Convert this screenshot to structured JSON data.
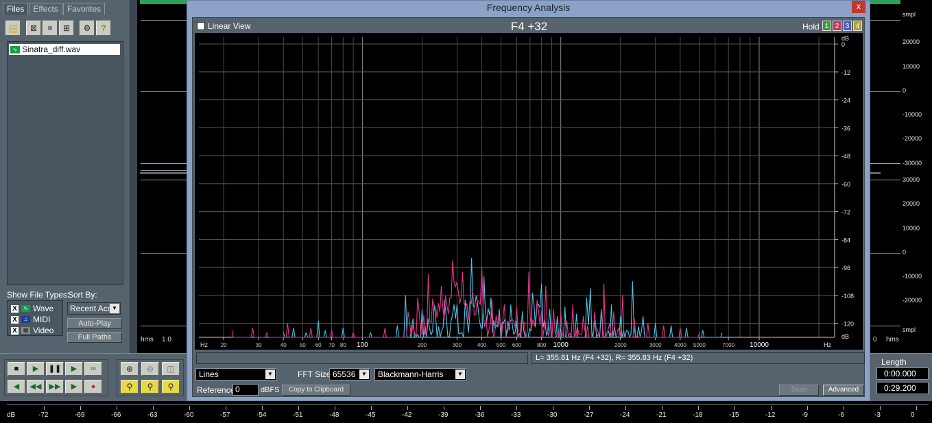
{
  "tabs": [
    "Files",
    "Effects",
    "Favorites"
  ],
  "file_list": {
    "items": [
      {
        "name": "Sinatra_diff.wav"
      }
    ]
  },
  "filters": {
    "show_file_types_label": "Show File Types:",
    "sort_by_label": "Sort By:",
    "types": [
      "Wave",
      "MIDI",
      "Video"
    ],
    "sort_value": "Recent Acc",
    "auto_play_label": "Auto-Play",
    "full_paths_label": "Full Paths"
  },
  "waveform": {
    "time_format_left": "hms",
    "zoom_left": "1.0",
    "time_format_right": "hms",
    "zoom_right": "0",
    "scale_top": [
      "smpl",
      "20000",
      "10000",
      "0",
      "-10000",
      "-20000",
      "-30000"
    ],
    "scale_bottom": [
      "30000",
      "20000",
      "10000",
      "0",
      "-10000",
      "-20000",
      "smpl"
    ]
  },
  "dialog": {
    "title": "Frequency Analysis",
    "close_label": "x",
    "linear_view_label": "Linear View",
    "note_title": "F4 +32",
    "hold_label": "Hold",
    "hold_buttons": [
      {
        "label": "1",
        "color": "#3c9a3a"
      },
      {
        "label": "2",
        "color": "#c03c58"
      },
      {
        "label": "3",
        "color": "#4c5cc8"
      },
      {
        "label": "4",
        "color": "#b8a032"
      }
    ],
    "status_text": "L= 355.81 Hz (F4 +32), R= 355.83 Hz (F4 +32)",
    "display_mode": "Lines",
    "fft_size_label": "FFT Size",
    "fft_size": "65536",
    "window_function": "Blackmann-Harris",
    "reference_label": "Reference",
    "reference_value": "0",
    "dbfs_label": "dBFS",
    "copy_label": "Copy to Clipboard",
    "scan_label": "Scan",
    "advanced_label": "Advanced"
  },
  "chart_data": {
    "type": "line",
    "title": "F4 +32",
    "xlabel": "Hz",
    "ylabel": "dB",
    "x_scale": "log",
    "xlim": [
      15,
      24000
    ],
    "ylim": [
      -126,
      3
    ],
    "x_ticks": [
      {
        "value": 20,
        "label": "20"
      },
      {
        "value": 30,
        "label": "30"
      },
      {
        "value": 40,
        "label": "40"
      },
      {
        "value": 50,
        "label": "50"
      },
      {
        "value": 60,
        "label": "60"
      },
      {
        "value": 70,
        "label": "70"
      },
      {
        "value": 80,
        "label": "80"
      },
      {
        "value": 100,
        "label": "100"
      },
      {
        "value": 200,
        "label": "200"
      },
      {
        "value": 300,
        "label": "300"
      },
      {
        "value": 400,
        "label": "400"
      },
      {
        "value": 500,
        "label": "500"
      },
      {
        "value": 600,
        "label": "600"
      },
      {
        "value": 800,
        "label": "800"
      },
      {
        "value": 1000,
        "label": "1000"
      },
      {
        "value": 2000,
        "label": "2000"
      },
      {
        "value": 3000,
        "label": "3000"
      },
      {
        "value": 4000,
        "label": "4000"
      },
      {
        "value": 5000,
        "label": "5000"
      },
      {
        "value": 7000,
        "label": "7000"
      },
      {
        "value": 10000,
        "label": "10000"
      }
    ],
    "y_ticks": [
      0,
      -12,
      -24,
      -36,
      -48,
      -60,
      -72,
      -84,
      -96,
      -108,
      -120
    ],
    "grid": true,
    "series": [
      {
        "color": "#4fc3e8",
        "points": [
          [
            40,
            -124
          ],
          [
            45,
            -122
          ],
          [
            52,
            -124
          ],
          [
            60,
            -119
          ],
          [
            65,
            -123
          ],
          [
            80,
            -122
          ],
          [
            110,
            -124
          ],
          [
            150,
            -121
          ],
          [
            165,
            -108
          ],
          [
            180,
            -118
          ],
          [
            200,
            -114
          ],
          [
            230,
            -112
          ],
          [
            260,
            -110
          ],
          [
            290,
            -112
          ],
          [
            300,
            -112
          ],
          [
            330,
            -110
          ],
          [
            355,
            -92
          ],
          [
            375,
            -108
          ],
          [
            410,
            -100
          ],
          [
            445,
            -109
          ],
          [
            490,
            -114
          ],
          [
            560,
            -112
          ],
          [
            640,
            -115
          ],
          [
            720,
            -107
          ],
          [
            800,
            -103
          ],
          [
            880,
            -114
          ],
          [
            960,
            -117
          ],
          [
            1050,
            -113
          ],
          [
            1200,
            -116
          ],
          [
            1350,
            -109
          ],
          [
            1410,
            -105
          ],
          [
            1600,
            -114
          ],
          [
            1800,
            -112
          ],
          [
            2000,
            -117
          ],
          [
            2300,
            -102
          ],
          [
            2600,
            -117
          ],
          [
            3000,
            -120
          ],
          [
            3600,
            -121
          ],
          [
            4300,
            -122
          ],
          [
            5200,
            -123
          ],
          [
            6500,
            -124
          ]
        ]
      },
      {
        "color": "#e8368a",
        "points": [
          [
            22,
            -123
          ],
          [
            28,
            -122
          ],
          [
            33,
            -124
          ],
          [
            42,
            -120
          ],
          [
            55,
            -122
          ],
          [
            70,
            -123
          ],
          [
            90,
            -124
          ],
          [
            130,
            -122
          ],
          [
            170,
            -115
          ],
          [
            190,
            -109
          ],
          [
            215,
            -99
          ],
          [
            250,
            -104
          ],
          [
            285,
            -93
          ],
          [
            320,
            -98
          ],
          [
            360,
            -106
          ],
          [
            400,
            -96
          ],
          [
            450,
            -110
          ],
          [
            520,
            -112
          ],
          [
            600,
            -113
          ],
          [
            690,
            -98
          ],
          [
            760,
            -110
          ],
          [
            840,
            -104
          ],
          [
            920,
            -114
          ],
          [
            1000,
            -115
          ],
          [
            1150,
            -112
          ],
          [
            1300,
            -117
          ],
          [
            1480,
            -115
          ],
          [
            1650,
            -103
          ],
          [
            1850,
            -115
          ],
          [
            2050,
            -108
          ],
          [
            2350,
            -118
          ],
          [
            2750,
            -120
          ],
          [
            3300,
            -121
          ],
          [
            4000,
            -122
          ],
          [
            5000,
            -124
          ]
        ]
      }
    ]
  },
  "transport": {
    "length_label": "Length",
    "position": "0:00.000",
    "length": "0:29.200"
  },
  "level_meter": {
    "unit": "dB",
    "ticks": [
      "-72",
      "-69",
      "-66",
      "-63",
      "-60",
      "-57",
      "-54",
      "-51",
      "-48",
      "-45",
      "-42",
      "-39",
      "-36",
      "-33",
      "-30",
      "-27",
      "-24",
      "-21",
      "-18",
      "-15",
      "-12",
      "-9",
      "-6",
      "-3",
      "0"
    ]
  }
}
